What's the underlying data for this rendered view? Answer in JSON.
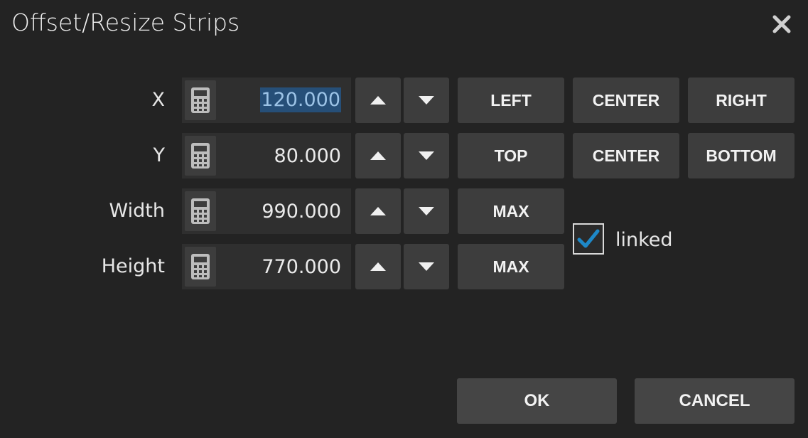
{
  "dialog": {
    "title": "Offset/Resize Strips"
  },
  "rows": [
    {
      "label": "X",
      "value": "120.000",
      "selected": true
    },
    {
      "label": "Y",
      "value": "80.000"
    },
    {
      "label": "Width",
      "value": "990.000"
    },
    {
      "label": "Height",
      "value": "770.000"
    }
  ],
  "x_align": {
    "left": "LEFT",
    "center": "CENTER",
    "right": "RIGHT"
  },
  "y_align": {
    "top": "TOP",
    "center": "CENTER",
    "bottom": "BOTTOM"
  },
  "width_max": "MAX",
  "height_max": "MAX",
  "linked": {
    "label": "linked",
    "checked": true
  },
  "footer": {
    "ok": "OK",
    "cancel": "CANCEL"
  },
  "icons": {
    "close": "close-icon",
    "calculator": "calculator-icon",
    "up": "arrow-up-icon",
    "down": "arrow-down-icon",
    "check": "checkmark-icon"
  },
  "colors": {
    "background": "#232323",
    "field": "#2f2f2f",
    "button": "#3d3d3d",
    "selection": "#264f78",
    "check": "#1e88c7"
  }
}
